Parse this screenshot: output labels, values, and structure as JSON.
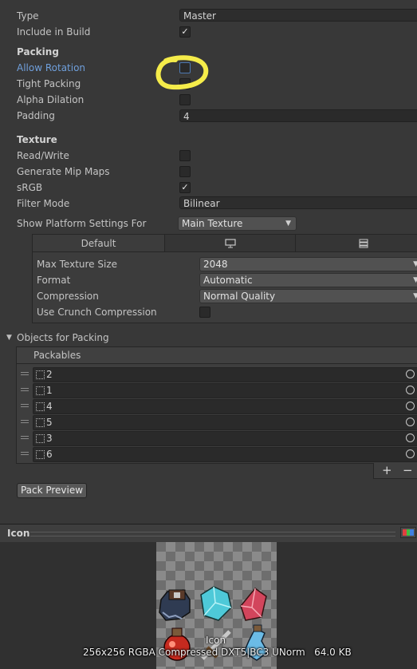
{
  "settings": {
    "type_label": "Type",
    "type_value": "Master",
    "include_in_build_label": "Include in Build",
    "include_in_build_checked": true
  },
  "packing": {
    "header": "Packing",
    "allow_rotation_label": "Allow Rotation",
    "allow_rotation_checked": false,
    "tight_packing_label": "Tight Packing",
    "tight_packing_checked": false,
    "alpha_dilation_label": "Alpha Dilation",
    "alpha_dilation_checked": false,
    "padding_label": "Padding",
    "padding_value": "4"
  },
  "texture": {
    "header": "Texture",
    "read_write_label": "Read/Write",
    "read_write_checked": false,
    "mipmaps_label": "Generate Mip Maps",
    "mipmaps_checked": false,
    "srgb_label": "sRGB",
    "srgb_checked": true,
    "filter_mode_label": "Filter Mode",
    "filter_mode_value": "Bilinear"
  },
  "platform": {
    "label": "Show Platform Settings For",
    "value": "Main Texture",
    "tabs": [
      {
        "label": "Default",
        "icon": "none"
      },
      {
        "label": "",
        "icon": "monitor-icon"
      },
      {
        "label": "",
        "icon": "grid-icon"
      }
    ],
    "max_texture_size_label": "Max Texture Size",
    "max_texture_size_value": "2048",
    "format_label": "Format",
    "format_value": "Automatic",
    "compression_label": "Compression",
    "compression_value": "Normal Quality",
    "crunch_label": "Use Crunch Compression",
    "crunch_checked": false
  },
  "objects": {
    "foldout_label": "Objects for Packing",
    "list_header": "Packables",
    "items": [
      "2",
      "1",
      "4",
      "5",
      "3",
      "6"
    ],
    "add_label": "+",
    "remove_label": "−",
    "pack_preview_label": "Pack Preview"
  },
  "preview": {
    "title": "Icon",
    "overlay_name": "Icon",
    "info": "256x256 RGBA Compressed DXT5|BC3 UNorm   64.0 KB"
  },
  "colors": {
    "highlight_circle": "#f5ec4a",
    "focused_label": "#6f9fdb"
  }
}
